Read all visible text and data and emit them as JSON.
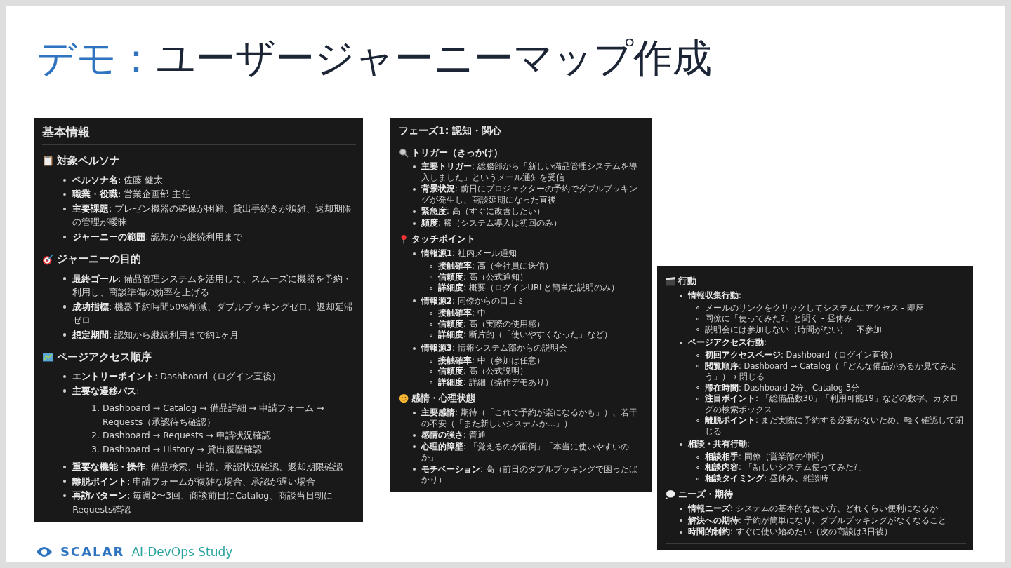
{
  "title": {
    "accent": "デモ：",
    "text": "ユーザージャーニーマップ作成"
  },
  "panels": [
    {
      "title": "基本情報",
      "sections": [
        {
          "heading": "対象ペルソナ",
          "items": [
            {
              "text": "**ペルソナ名**: 佐藤 健太"
            },
            {
              "text": "**職業・役職**: 営業企画部 主任"
            },
            {
              "text": "**主要課題**: プレゼン機器の確保が困難、貸出手続きが煩雑、返却期限の管理が曖昧"
            },
            {
              "text": "**ジャーニーの範囲**: 認知から継続利用まで"
            }
          ]
        },
        {
          "heading": "ジャーニーの目的",
          "items": [
            {
              "text": "**最終ゴール**: 備品管理システムを活用して、スムーズに機器を予約・利用し、商談準備の効率を上げる"
            },
            {
              "text": "**成功指標**: 機器予約時間50%削減、ダブルブッキングゼロ、返却延滞ゼロ"
            },
            {
              "text": "**想定期間**: 認知から継続利用まで約1ヶ月"
            }
          ]
        },
        {
          "heading": "ページアクセス順序",
          "items": [
            {
              "text": "**エントリーポイント**: Dashboard（ログイン直後）"
            },
            {
              "text": "**主要な遷移パス**:",
              "children": [
                {
                  "number": "1.",
                  "text": "Dashboard → Catalog → 備品詳細 → 申請フォーム → Requests（承認待ち確認）"
                },
                {
                  "number": "2.",
                  "text": "Dashboard → Requests → 申請状況確認"
                },
                {
                  "number": "3.",
                  "text": "Dashboard → History → 貸出履歴確認"
                }
              ]
            },
            {
              "text": "**重要な機能・操作**: 備品検索、申請、承認状況確認、返却期限確認"
            },
            {
              "text": "**離脱ポイント**: 申請フォームが複雑な場合、承認が遅い場合"
            },
            {
              "text": "**再訪パターン**: 毎週2〜3回、商談前日にCatalog、商談当日朝にRequests確認"
            }
          ]
        }
      ]
    },
    {
      "title": "フェーズ1: 認知・関心",
      "sections": [
        {
          "heading": "トリガー（きっかけ）",
          "items": [
            {
              "text": "**主要トリガー**: 総務部から「新しい備品管理システムを導入しました」というメール通知を受信"
            },
            {
              "text": "**背景状況**: 前日にプロジェクターの予約でダブルブッキングが発生し、商談延期になった直後"
            },
            {
              "text": "**緊急度**: 高（すぐに改善したい）"
            },
            {
              "text": "**頻度**: 稀（システム導入は初回のみ）"
            }
          ]
        },
        {
          "heading": "タッチポイント",
          "items": [
            {
              "text": "**情報源1**: 社内メール通知",
              "children": [
                {
                  "text": "**接触確率**: 高（全社員に送信）"
                },
                {
                  "text": "**信頼度**: 高（公式通知）"
                },
                {
                  "text": "**詳細度**: 概要（ログインURLと簡単な説明のみ）"
                }
              ]
            },
            {
              "text": "**情報源2**: 同僚からの口コミ",
              "children": [
                {
                  "text": "**接触確率**: 中"
                },
                {
                  "text": "**信頼度**: 高（実際の使用感）"
                },
                {
                  "text": "**詳細度**: 断片的（「使いやすくなった」など）"
                }
              ]
            },
            {
              "text": "**情報源3**: 情報システム部からの説明会",
              "children": [
                {
                  "text": "**接触確率**: 中（参加は任意）"
                },
                {
                  "text": "**信頼度**: 高（公式説明）"
                },
                {
                  "text": "**詳細度**: 詳細（操作デモあり）"
                }
              ]
            }
          ]
        },
        {
          "heading": "感情・心理状態",
          "items": [
            {
              "text": "**主要感情**: 期待（「これで予約が楽になるかも」）、若干の不安（「また新しいシステムか...」）"
            },
            {
              "text": "**感情の強さ**: 普通"
            },
            {
              "text": "**心理的障壁**: 「覚えるのが面倒」「本当に使いやすいのか」"
            },
            {
              "text": "**モチベーション**: 高（前日のダブルブッキングで困ったばかり）"
            }
          ]
        }
      ]
    },
    {
      "sections": [
        {
          "heading": "行動",
          "items": [
            {
              "text": "**情報収集行動**:",
              "children": [
                {
                  "text": "メールのリンクをクリックしてシステムにアクセス - 即座"
                },
                {
                  "text": "同僚に「使ってみた?」と聞く - 昼休み"
                },
                {
                  "text": "説明会には参加しない（時間がない） - 不参加"
                }
              ]
            },
            {
              "text": "**ページアクセス行動**:",
              "children": [
                {
                  "text": "**初回アクセスページ**: Dashboard（ログイン直後）"
                },
                {
                  "text": "**閲覧順序**: Dashboard → Catalog（「どんな備品があるか見てみよう」）→ 閉じる"
                },
                {
                  "text": "**滞在時間**: Dashboard 2分、Catalog 3分"
                },
                {
                  "text": "**注目ポイント**: 「総備品数30」「利用可能19」などの数字、カタログの検索ボックス"
                },
                {
                  "text": "**離脱ポイント**: まだ実際に予約する必要がないため、軽く確認して閉じる"
                }
              ]
            },
            {
              "text": "**相談・共有行動**:",
              "children": [
                {
                  "text": "**相談相手**: 同僚（営業部の仲間）"
                },
                {
                  "text": "**相談内容**: 「新しいシステム使ってみた?」"
                },
                {
                  "text": "**相談タイミング**: 昼休み、雑談時"
                }
              ]
            }
          ]
        },
        {
          "heading": "ニーズ・期待",
          "items": [
            {
              "text": "**情報ニーズ**: システムの基本的な使い方、どれくらい便利になるか"
            },
            {
              "text": "**解決への期待**: 予約が簡単になり、ダブルブッキングがなくなること"
            },
            {
              "text": "**時間的制約**: すぐに使い始めたい（次の商談は3日後）"
            }
          ]
        }
      ]
    }
  ],
  "footer": {
    "brand": "SCALAR",
    "subtitle": "AI-DevOps Study"
  }
}
